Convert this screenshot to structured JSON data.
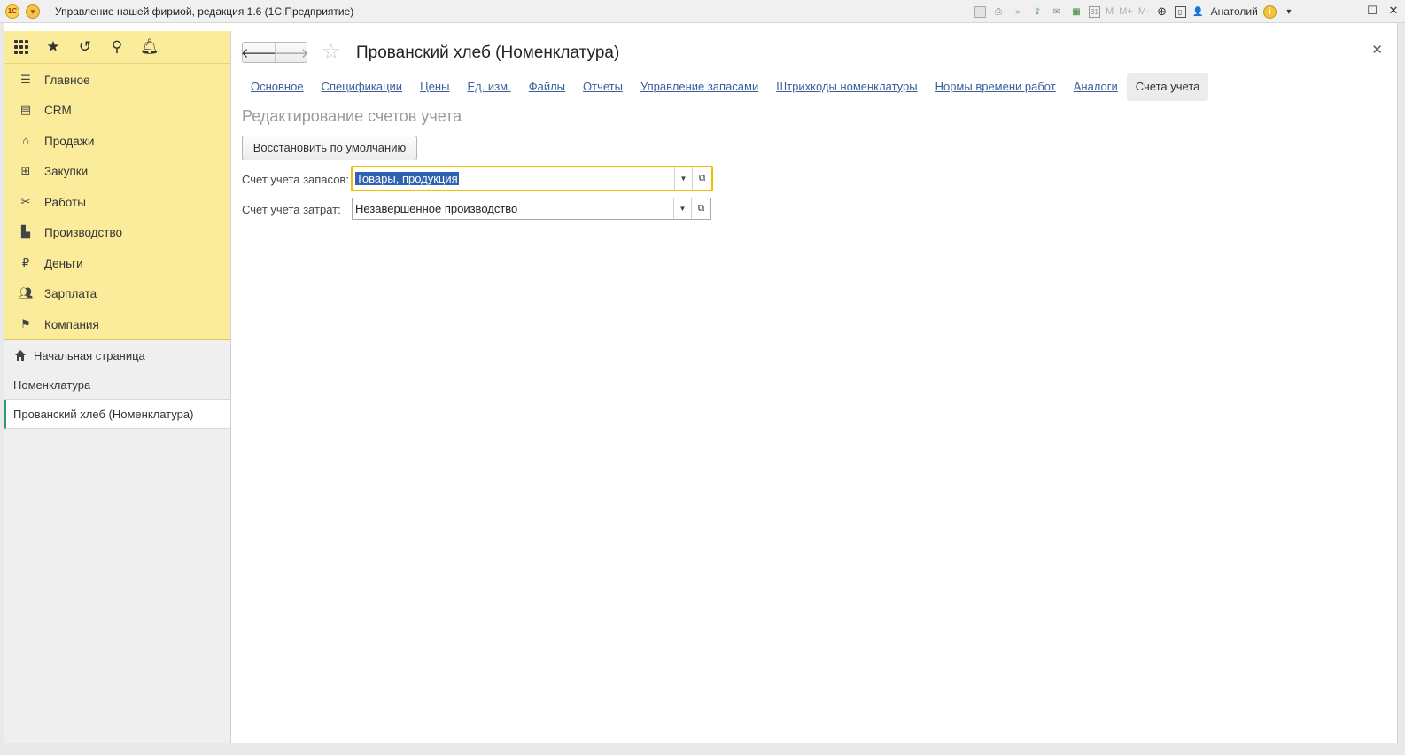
{
  "window": {
    "title": "Управление нашей фирмой, редакция 1.6  (1С:Предприятие)",
    "logo_text": "1С",
    "user": "Анатолий",
    "toolbar_m": [
      "M",
      "M+",
      "M-"
    ],
    "calendar_day": "31"
  },
  "sidebar": {
    "top_icons": [
      "apps-icon",
      "star-icon",
      "history-icon",
      "search-icon",
      "bell-icon"
    ],
    "sections": [
      {
        "label": "Главное",
        "icon": "menu-icon"
      },
      {
        "label": "CRM",
        "icon": "crm-icon"
      },
      {
        "label": "Продажи",
        "icon": "basket-icon"
      },
      {
        "label": "Закупки",
        "icon": "cart-icon"
      },
      {
        "label": "Работы",
        "icon": "tools-icon"
      },
      {
        "label": "Производство",
        "icon": "factory-icon"
      },
      {
        "label": "Деньги",
        "icon": "ruble-icon"
      },
      {
        "label": "Зарплата",
        "icon": "people-icon"
      },
      {
        "label": "Компания",
        "icon": "flag-icon"
      }
    ],
    "open_windows": [
      {
        "label": "Начальная страница",
        "icon": "home-icon"
      },
      {
        "label": "Номенклатура"
      },
      {
        "label": "Прованский хлеб (Номенклатура)",
        "active": true
      }
    ]
  },
  "main": {
    "title": "Прованский хлеб (Номенклатура)",
    "tabs": [
      {
        "label": "Основное"
      },
      {
        "label": "Спецификации"
      },
      {
        "label": "Цены"
      },
      {
        "label": "Ед. изм."
      },
      {
        "label": "Файлы"
      },
      {
        "label": "Отчеты"
      },
      {
        "label": "Управление запасами"
      },
      {
        "label": "Штрихкоды номенклатуры"
      },
      {
        "label": "Нормы времени работ"
      },
      {
        "label": "Аналоги"
      },
      {
        "label": "Счета учета",
        "active": true
      }
    ],
    "section_title": "Редактирование счетов учета",
    "restore_button": "Восстановить по умолчанию",
    "fields": [
      {
        "label": "Счет учета запасов:",
        "value": "Товары, продукция",
        "focused": true,
        "selected": true
      },
      {
        "label": "Счет учета затрат:",
        "value": "Незавершенное производство"
      }
    ]
  },
  "colors": {
    "sidebar_bg": "#fbec9b",
    "focus_border": "#f0c000",
    "link": "#3a5f9a",
    "selection": "#3062b4",
    "active_marker": "#2e9b6a"
  }
}
